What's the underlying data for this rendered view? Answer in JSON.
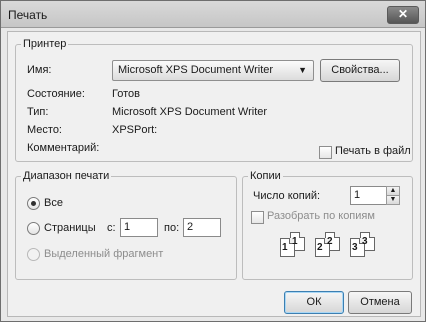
{
  "window": {
    "title": "Печать"
  },
  "printer": {
    "group_label": "Принтер",
    "name_label": "Имя:",
    "name_value": "Microsoft XPS Document Writer",
    "properties_button": "Свойства...",
    "status_label": "Состояние:",
    "status_value": "Готов",
    "type_label": "Тип:",
    "type_value": "Microsoft XPS Document Writer",
    "where_label": "Место:",
    "where_value": "XPSPort:",
    "comment_label": "Комментарий:",
    "print_to_file_label": "Печать в файл"
  },
  "range": {
    "group_label": "Диапазон печати",
    "all_label": "Все",
    "pages_label": "Страницы",
    "from_label": "с:",
    "from_value": "1",
    "to_label": "по:",
    "to_value": "2",
    "selection_label": "Выделенный фрагмент"
  },
  "copies": {
    "group_label": "Копии",
    "count_label": "Число копий:",
    "count_value": "1",
    "collate_label": "Разобрать по копиям",
    "collate_pages": [
      "1",
      "1",
      "2",
      "2",
      "3",
      "3"
    ]
  },
  "buttons": {
    "ok": "ОК",
    "cancel": "Отмена"
  }
}
